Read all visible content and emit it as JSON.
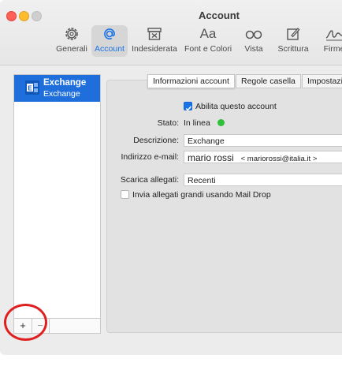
{
  "window": {
    "title": "Account"
  },
  "toolbar": {
    "items": [
      {
        "label": "Generali",
        "icon": "gear-icon"
      },
      {
        "label": "Account",
        "icon": "at-sign-icon",
        "active": true
      },
      {
        "label": "Indesiderata",
        "icon": "junk-bin-icon"
      },
      {
        "label": "Font e Colori",
        "icon": "font-icon"
      },
      {
        "label": "Vista",
        "icon": "glasses-icon"
      },
      {
        "label": "Scrittura",
        "icon": "compose-icon"
      },
      {
        "label": "Firme",
        "icon": "signature-icon"
      }
    ],
    "font_glyph": "Aa"
  },
  "sidebar": {
    "accounts": [
      {
        "name": "Exchange",
        "type": "Exchange",
        "icon": "exchange-icon"
      }
    ],
    "add_label": "+",
    "remove_label": "−"
  },
  "tabs": {
    "items": [
      {
        "label": "Informazioni account",
        "selected": true
      },
      {
        "label": "Regole casella",
        "selected": false
      },
      {
        "label": "Impostazioni",
        "selected": false
      }
    ]
  },
  "form": {
    "enable_label": "Abilita questo account",
    "enable_checked": true,
    "status_label": "Stato:",
    "status_value": "In linea",
    "status_color": "#2fbf3a",
    "description_label": "Descrizione:",
    "description_value": "Exchange",
    "email_label": "Indirizzo e-mail:",
    "email_name": "mario rossi",
    "email_address": "< mariorossi@italia.it >",
    "attachments_label": "Scarica allegati:",
    "attachments_value": "Recenti",
    "maildrop_label": "Invia allegati grandi usando Mail Drop",
    "maildrop_checked": false
  },
  "colors": {
    "accent": "#1a73e8",
    "selection": "#1e6fdc",
    "highlight_circle": "#e02020"
  }
}
